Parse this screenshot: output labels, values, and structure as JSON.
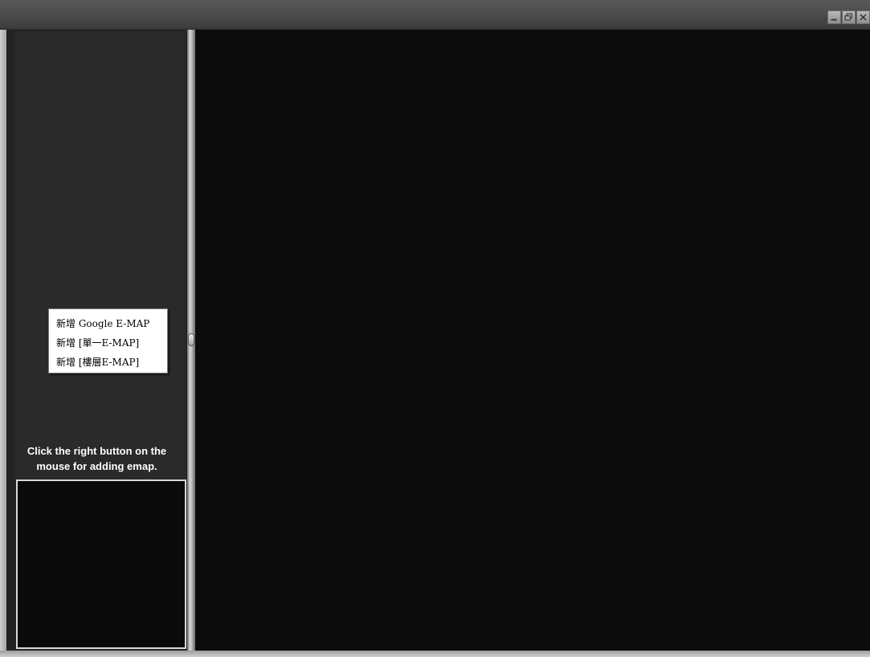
{
  "window": {
    "controls": [
      {
        "name": "minimize",
        "icon": "minimize-icon"
      },
      {
        "name": "restore",
        "icon": "restore-icon"
      },
      {
        "name": "close",
        "icon": "close-icon"
      }
    ]
  },
  "context_menu": {
    "items": [
      {
        "label": "新增 Google E-MAP"
      },
      {
        "label": "新增 [單一E-MAP]"
      },
      {
        "label": "新增 [樓層E-MAP]"
      }
    ]
  },
  "sidebar": {
    "hint_line1": "Click the right button on the",
    "hint_line2": "mouse for adding emap."
  },
  "colors": {
    "titlebar": "#4d4d4d",
    "sidebar": "#2b2a2b",
    "main_view": "#0c0c0c",
    "menu_bg": "#ffffff",
    "hint_text": "#ffffff"
  }
}
